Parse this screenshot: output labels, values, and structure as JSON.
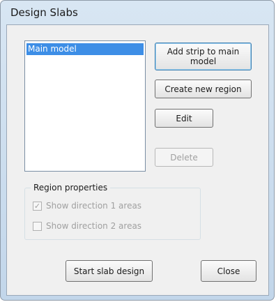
{
  "window": {
    "title": "Design Slabs"
  },
  "list": {
    "items": [
      "Main model"
    ],
    "selected_index": 0
  },
  "buttons": {
    "add_strip": "Add strip to main model",
    "create_region": "Create new region",
    "edit": "Edit",
    "delete": "Delete",
    "start_design": "Start slab design",
    "close": "Close"
  },
  "region_properties": {
    "label": "Region properties",
    "show_dir1": {
      "label": "Show direction 1 areas",
      "checked": true,
      "enabled": false
    },
    "show_dir2": {
      "label": "Show direction 2 areas",
      "checked": false,
      "enabled": false
    }
  },
  "colors": {
    "selection": "#3d8ee6",
    "client_bg": "#f0f0f0",
    "disabled_text": "#a0a0a0"
  }
}
